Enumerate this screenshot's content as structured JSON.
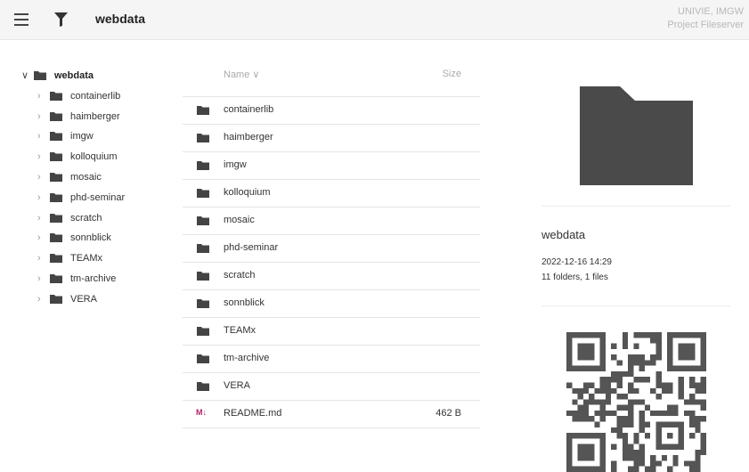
{
  "header": {
    "title": "webdata",
    "brand_line1": "UNIVIE, IMGW",
    "brand_line2": "Project Fileserver"
  },
  "tree": {
    "root": "webdata",
    "children": [
      "containerlib",
      "haimberger",
      "imgw",
      "kolloquium",
      "mosaic",
      "phd-seminar",
      "scratch",
      "sonnblick",
      "TEAMx",
      "tm-archive",
      "VERA"
    ]
  },
  "list": {
    "col_name": "Name ∨",
    "col_size": "Size",
    "rows": [
      {
        "name": "containerlib",
        "size": "",
        "type": "folder"
      },
      {
        "name": "haimberger",
        "size": "",
        "type": "folder"
      },
      {
        "name": "imgw",
        "size": "",
        "type": "folder"
      },
      {
        "name": "kolloquium",
        "size": "",
        "type": "folder"
      },
      {
        "name": "mosaic",
        "size": "",
        "type": "folder"
      },
      {
        "name": "phd-seminar",
        "size": "",
        "type": "folder"
      },
      {
        "name": "scratch",
        "size": "",
        "type": "folder"
      },
      {
        "name": "sonnblick",
        "size": "",
        "type": "folder"
      },
      {
        "name": "TEAMx",
        "size": "",
        "type": "folder"
      },
      {
        "name": "tm-archive",
        "size": "",
        "type": "folder"
      },
      {
        "name": "VERA",
        "size": "",
        "type": "folder"
      },
      {
        "name": "README.md",
        "size": "462 B",
        "type": "markdown",
        "badge": "M↓"
      }
    ]
  },
  "details": {
    "name": "webdata",
    "modified": "2022-12-16 14:29",
    "counts": "11 folders, 1 files"
  },
  "colors": {
    "folder": "#444444",
    "markdown_badge": "#b0246a",
    "muted": "#aaaaaa"
  },
  "icons": {
    "menu": "menu-icon",
    "filter": "filter-icon",
    "folder": "folder-icon",
    "markdown": "markdown-icon",
    "qr": "qr-code-icon"
  }
}
